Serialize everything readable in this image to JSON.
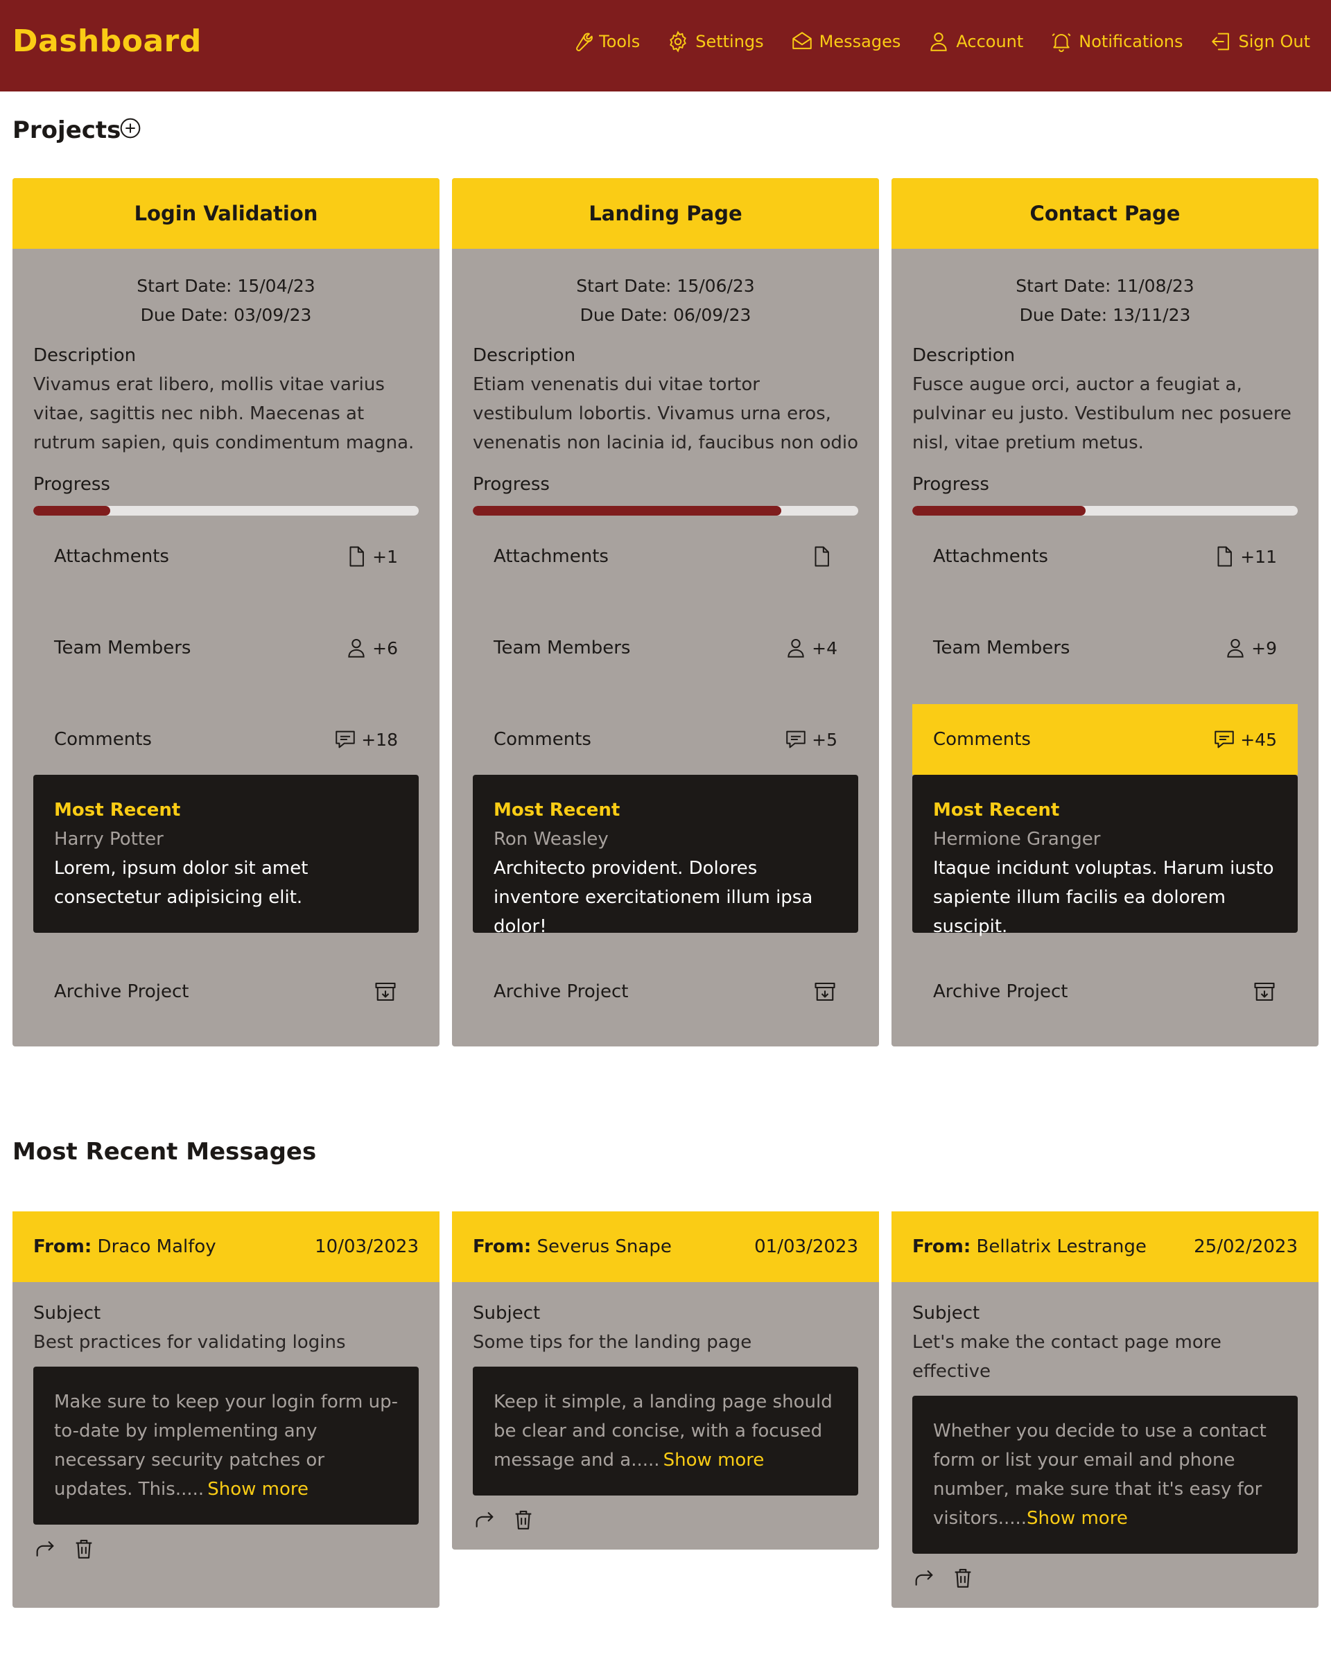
{
  "header": {
    "title": "Dashboard",
    "nav": [
      {
        "label": "Tools",
        "icon": "wrench-icon"
      },
      {
        "label": "Settings",
        "icon": "gear-icon"
      },
      {
        "label": "Messages",
        "icon": "envelope-icon"
      },
      {
        "label": "Account",
        "icon": "user-icon"
      },
      {
        "label": "Notifications",
        "icon": "bell-icon"
      },
      {
        "label": "Sign Out",
        "icon": "sign-out-icon"
      }
    ]
  },
  "projects": {
    "title": "Projects",
    "add_icon": "plus-circle-icon",
    "items": [
      {
        "name": "Login Validation",
        "start": "Start Date: 15/04/23",
        "due": "Due Date: 03/09/23",
        "description_label": "Description",
        "description": "Vivamus erat libero, mollis vitae varius vitae, sagittis nec nibh. Maecenas at rutrum sapien, quis condimentum magna.",
        "progress_label": "Progress",
        "progress": 0.2,
        "attachments_label": "Attachments",
        "attachments_count": "+1",
        "team_label": "Team Members",
        "team_count": "+6",
        "comments_label": "Comments",
        "comments_count": "+18",
        "comments_highlight": false,
        "recent_title": "Most Recent",
        "recent_author": "Harry Potter",
        "recent_text": "Lorem, ipsum dolor sit amet consectetur adipisicing elit.",
        "archive_label": "Archive Project"
      },
      {
        "name": "Landing Page",
        "start": "Start Date: 15/06/23",
        "due": "Due Date: 06/09/23",
        "description_label": "Description",
        "description": "Etiam venenatis dui vitae tortor vestibulum lobortis. Vivamus urna eros, venenatis non lacinia id, faucibus non odio",
        "progress_label": "Progress",
        "progress": 0.8,
        "attachments_label": "Attachments",
        "attachments_count": "",
        "team_label": "Team Members",
        "team_count": "+4",
        "comments_label": "Comments",
        "comments_count": "+5",
        "comments_highlight": false,
        "recent_title": "Most Recent",
        "recent_author": "Ron Weasley",
        "recent_text": "Architecto provident. Dolores inventore exercitationem illum ipsa dolor!",
        "archive_label": "Archive Project"
      },
      {
        "name": "Contact Page",
        "start": "Start Date: 11/08/23",
        "due": "Due Date: 13/11/23",
        "description_label": "Description",
        "description": "Fusce augue orci, auctor a feugiat a, pulvinar eu justo. Vestibulum nec posuere nisl, vitae pretium metus.",
        "progress_label": "Progress",
        "progress": 0.45,
        "attachments_label": "Attachments",
        "attachments_count": "+11",
        "team_label": "Team Members",
        "team_count": "+9",
        "comments_label": "Comments",
        "comments_count": "+45",
        "comments_highlight": true,
        "recent_title": "Most Recent",
        "recent_author": "Hermione Granger",
        "recent_text": "Itaque incidunt voluptas. Harum iusto sapiente illum facilis ea dolorem suscipit.",
        "archive_label": "Archive Project"
      }
    ]
  },
  "messages": {
    "title": "Most Recent Messages",
    "items": [
      {
        "from_label": "From:",
        "from": "Draco Malfoy",
        "date": "10/03/2023",
        "subject_label": "Subject",
        "subject": "Best practices for validating logins",
        "body": "Make sure to keep your login form up-to-date by implementing any necessary security patches or updates. This.....",
        "show_more": "Show more"
      },
      {
        "from_label": "From:",
        "from": "Severus Snape",
        "date": "01/03/2023",
        "subject_label": "Subject",
        "subject": "Some tips for the landing page",
        "body": "Keep it simple, a landing page should be clear and concise, with a focused message and a.....",
        "show_more": "Show more"
      },
      {
        "from_label": "From:",
        "from": "Bellatrix Lestrange",
        "date": "25/02/2023",
        "subject_label": "Subject",
        "subject": "Let's make the contact page more effective",
        "body": "Whether you decide to use a contact form or list your email and phone number, make sure that it's easy for visitors.....",
        "show_more": "Show more"
      }
    ]
  },
  "colors": {
    "header_bg": "#7f1d1d",
    "accent": "#facc15",
    "card_bg": "#a8a29e",
    "dark": "#1c1917",
    "progress_fill": "#7f1d1d",
    "progress_track": "#e7e5e4"
  }
}
